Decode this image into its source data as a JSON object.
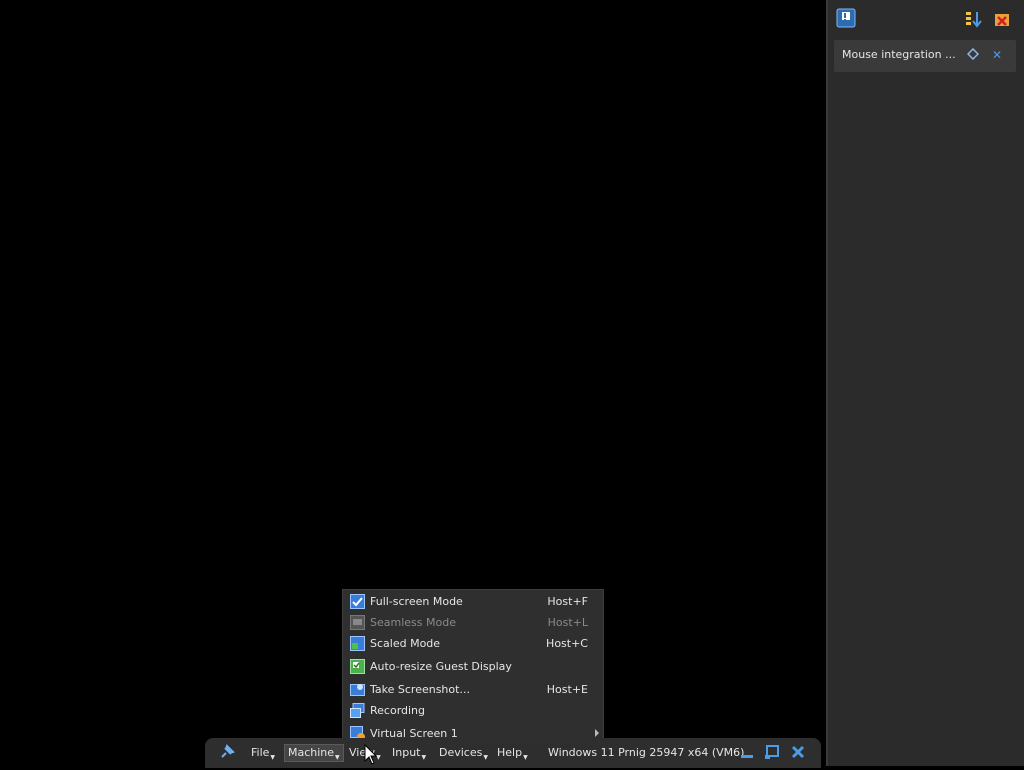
{
  "side_panel": {
    "message_text": "Mouse integration ...",
    "icons": [
      "notification-icon",
      "sort-icon",
      "clear-all-icon",
      "pin-message-icon",
      "close-message-icon"
    ],
    "accent": "#4a9be8"
  },
  "view_menu": {
    "items": [
      {
        "label": "Full-screen Mode",
        "shortcut": "Host+F",
        "icon": "fullscreen-icon",
        "enabled": true
      },
      {
        "label": "Seamless Mode",
        "shortcut": "Host+L",
        "icon": "seamless-icon",
        "enabled": false
      },
      {
        "label": "Scaled Mode",
        "shortcut": "Host+C",
        "icon": "scaled-icon",
        "enabled": true
      },
      {
        "label": "Auto-resize Guest Display",
        "shortcut": "",
        "icon": "auto-resize-icon",
        "enabled": true
      },
      {
        "label": "Take Screenshot...",
        "shortcut": "Host+E",
        "icon": "screenshot-icon",
        "enabled": true
      },
      {
        "label": "Recording",
        "shortcut": "",
        "icon": "recording-icon",
        "enabled": true
      },
      {
        "label": "Virtual Screen 1",
        "shortcut": "",
        "icon": "virtual-screen-icon",
        "enabled": true,
        "submenu": true
      }
    ]
  },
  "toolbar": {
    "menus": [
      {
        "label": "File",
        "active": false
      },
      {
        "label": "Machine",
        "active": true
      },
      {
        "label": "View",
        "active": false
      },
      {
        "label": "Input",
        "active": false
      },
      {
        "label": "Devices",
        "active": false
      },
      {
        "label": "Help",
        "active": false
      }
    ],
    "vm_title": "Windows 11 Prnig 25947 x64 (VM6)"
  }
}
